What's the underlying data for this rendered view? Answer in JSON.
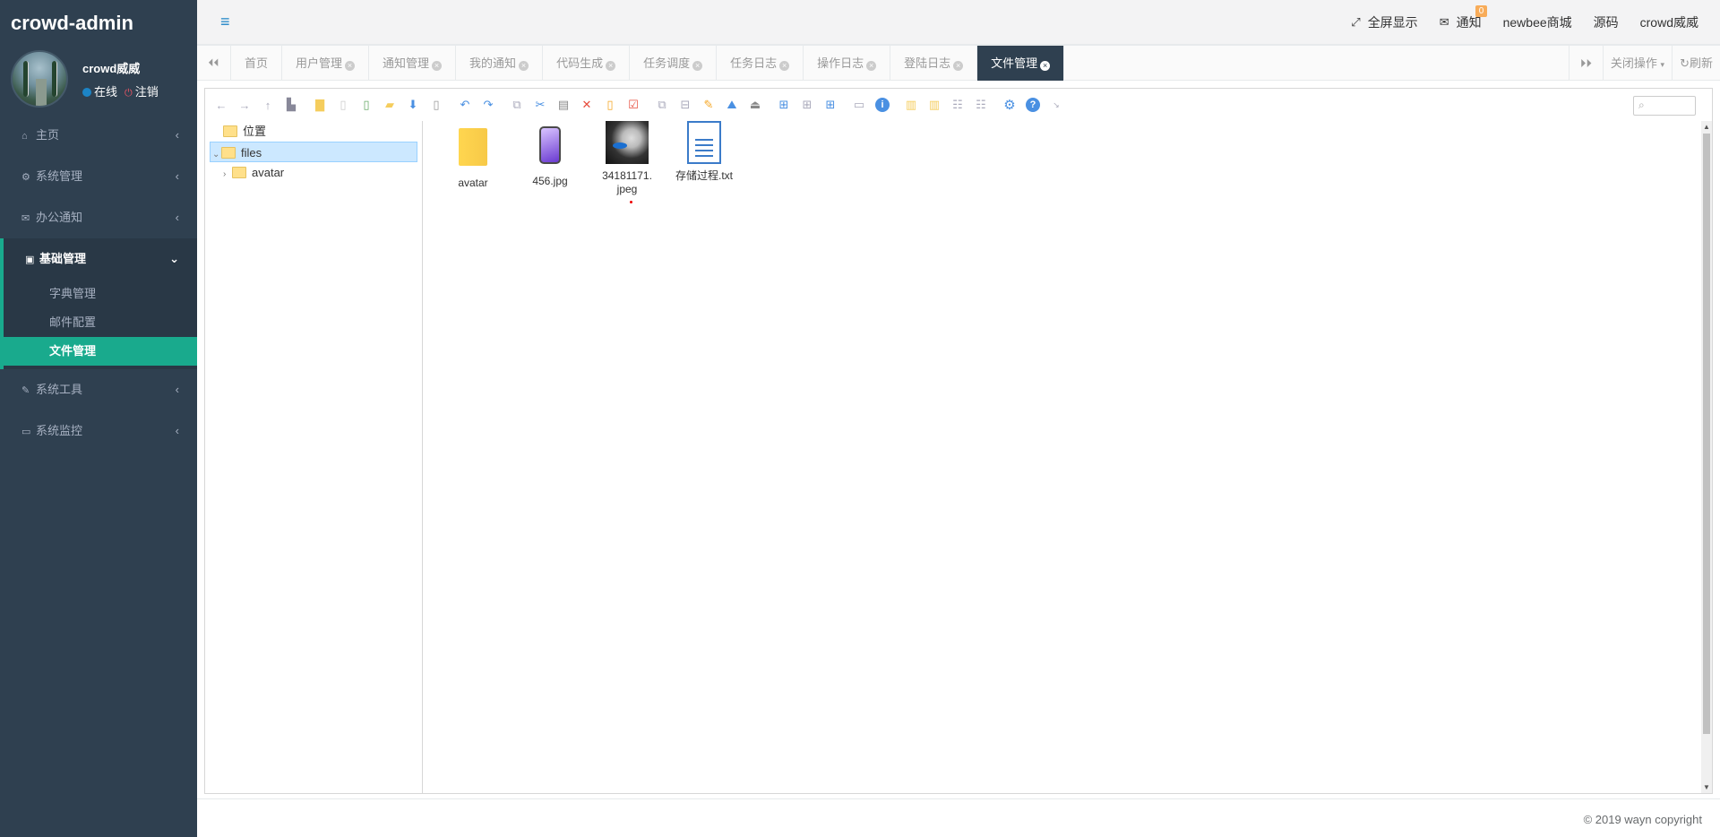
{
  "app": {
    "brand": "crowd-admin"
  },
  "profile": {
    "name": "crowd威威",
    "status": "在线",
    "logout": "注销"
  },
  "sidebar": {
    "items": [
      {
        "label": "主页",
        "icon": "home-icon"
      },
      {
        "label": "系统管理",
        "icon": "gear-icon"
      },
      {
        "label": "办公通知",
        "icon": "envelope-icon"
      }
    ],
    "group": {
      "label": "基础管理",
      "icon": "id-card-icon",
      "children": [
        "字典管理",
        "邮件配置",
        "文件管理"
      ]
    },
    "items_after": [
      {
        "label": "系统工具",
        "icon": "wrench-icon"
      },
      {
        "label": "系统监控",
        "icon": "monitor-icon"
      }
    ]
  },
  "topbar": {
    "fullscreen": "全屏显示",
    "notify": "通知",
    "notify_count": "0",
    "shop": "newbee商城",
    "source": "源码",
    "user": "crowd威威"
  },
  "tabs": [
    "首页",
    "用户管理",
    "通知管理",
    "我的通知",
    "代码生成",
    "任务调度",
    "任务日志",
    "操作日志",
    "登陆日志",
    "文件管理"
  ],
  "tab_actions": {
    "close": "关闭操作",
    "refresh": "刷新"
  },
  "tree": {
    "root": "位置",
    "selected": "files",
    "child": "avatar"
  },
  "files": [
    {
      "name": "avatar",
      "type": "folder"
    },
    {
      "name": "456.jpg",
      "type": "image"
    },
    {
      "name": "34181171.jpeg",
      "type": "photo"
    },
    {
      "name": "存储过程.txt",
      "type": "text"
    }
  ],
  "footer": {
    "copyright": "© 2019 wayn copyright"
  },
  "colors": {
    "sidebar": "#2f4050",
    "accent": "#19aa8d",
    "active_tab": "#2f4050",
    "badge": "#f8ac59"
  }
}
